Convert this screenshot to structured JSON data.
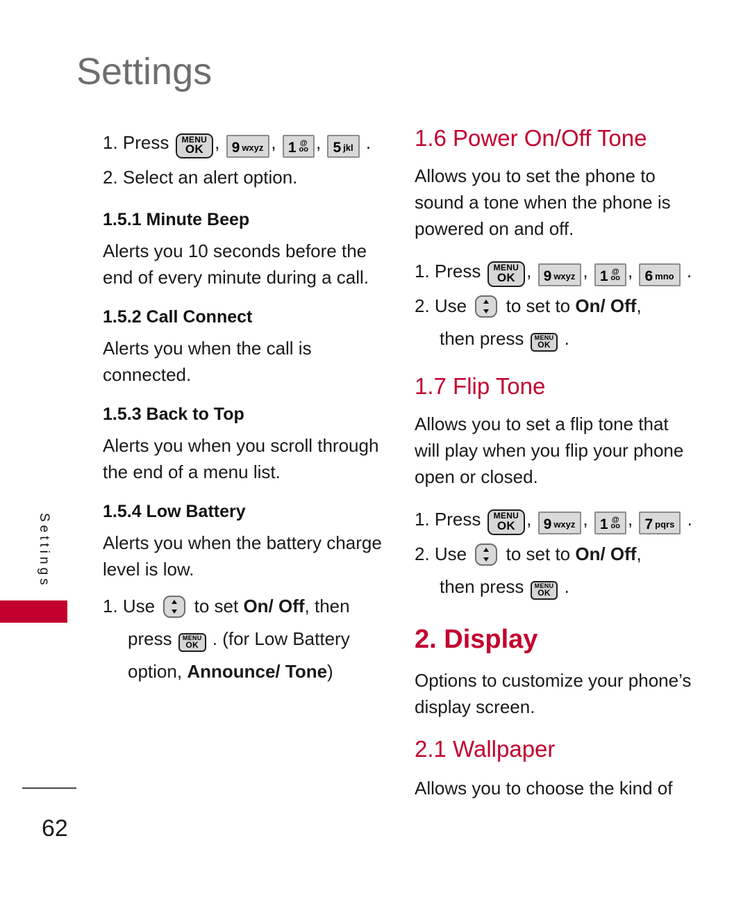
{
  "page": {
    "title": "Settings",
    "number": "62",
    "side_tab_label": "Settings",
    "accent_color": "#C2002F",
    "title_color": "#6E6E6E"
  },
  "keys": {
    "menu_ok_top": "MENU",
    "menu_ok_bottom": "OK",
    "k9_num": "9",
    "k9_sub": "wxyz",
    "k1_num": "1",
    "k1_top": "@",
    "k1_bottom": "oo",
    "k5_num": "5",
    "k5_sub": "jkl",
    "k6_num": "6",
    "k6_sub": "mno",
    "k7_num": "7",
    "k7_sub": "pqrs",
    "nav_key_name": "navigation-key"
  },
  "left_column": {
    "step1_prefix": "1. Press",
    "step1_sep": ",",
    "step1_end": ".",
    "step2": "2. Select an alert option.",
    "sections": [
      {
        "heading": "1.5.1 Minute Beep",
        "body": "Alerts you 10 seconds before the end of every minute during a call."
      },
      {
        "heading": "1.5.2 Call Connect",
        "body": "Alerts you when the call is connected."
      },
      {
        "heading": "1.5.3 Back to Top",
        "body": "Alerts you when you scroll through the end of a menu list."
      },
      {
        "heading": "1.5.4 Low Battery",
        "body": "Alerts you when the battery charge level is low."
      }
    ],
    "low_battery_step": {
      "prefix": "1. Use",
      "mid": "to set",
      "on_off": "On/ Off",
      "after": ", then",
      "line2_prefix": "press",
      "line2_after": ". (for Low Battery",
      "line3_prefix": "option,",
      "line3_bold": "Announce/ Tone",
      "line3_after": ")"
    }
  },
  "right_column": {
    "sections": [
      {
        "heading": "1.6 Power On/Off Tone",
        "body": "Allows you to set the phone to sound a tone when the phone is powered on and off.",
        "step1_prefix": "1. Press",
        "step1_end": ".",
        "step2_prefix": "2. Use",
        "step2_mid": "to set to",
        "step2_on_off": "On/ Off",
        "step2_after": ",",
        "step3_prefix": "then press",
        "step3_after": "."
      },
      {
        "heading": "1.7 Flip Tone",
        "body": "Allows you to set a flip tone that will play when you flip your phone open or closed.",
        "step1_prefix": "1. Press",
        "step1_end": ".",
        "step2_prefix": "2. Use",
        "step2_mid": "to set to",
        "step2_on_off": "On/ Off",
        "step2_after": ",",
        "step3_prefix": "then press",
        "step3_after": "."
      }
    ],
    "display_heading": "2. Display",
    "display_body": "Options to customize your phone’s display screen.",
    "wallpaper_heading": "2.1 Wallpaper",
    "wallpaper_body": "Allows you to choose the kind of"
  }
}
